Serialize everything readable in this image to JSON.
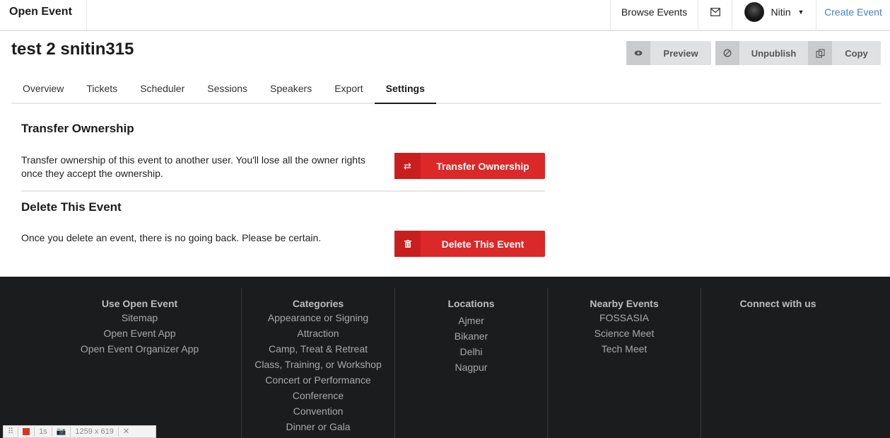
{
  "navbar": {
    "brand": "Open Event",
    "browse_events": "Browse Events",
    "mail_icon": "mail-icon",
    "user_name": "Nitin",
    "create_event": "Create Event"
  },
  "header": {
    "title": "test 2 snitin315",
    "preview": "Preview",
    "unpublish": "Unpublish",
    "copy": "Copy"
  },
  "tabs": [
    "Overview",
    "Tickets",
    "Scheduler",
    "Sessions",
    "Speakers",
    "Export",
    "Settings"
  ],
  "active_tab": "Settings",
  "transfer": {
    "title": "Transfer Ownership",
    "text": "Transfer ownership of this event to another user. You'll lose all the owner rights once they accept the ownership.",
    "button": "Transfer Ownership",
    "icon": "exchange-icon"
  },
  "delete": {
    "title": "Delete This Event",
    "text": "Once you delete an event, there is no going back. Please be certain.",
    "button": "Delete This Event",
    "icon": "trash-icon"
  },
  "footer": {
    "use": {
      "title": "Use Open Event",
      "links": [
        "Sitemap",
        "Open Event App",
        "Open Event Organizer App"
      ]
    },
    "categories": {
      "title": "Categories",
      "links": [
        "Appearance or Signing",
        "Attraction",
        "Camp, Treat & Retreat",
        "Class, Training, or Workshop",
        "Concert or Performance",
        "Conference",
        "Convention",
        "Dinner or Gala"
      ]
    },
    "locations": {
      "title": "Locations",
      "links": [
        "Ajmer",
        "Bikaner",
        "Delhi",
        "Nagpur"
      ]
    },
    "nearby": {
      "title": "Nearby Events",
      "links": [
        "FOSSASIA",
        "Science Meet",
        "Tech Meet"
      ]
    },
    "connect": {
      "title": "Connect with us"
    }
  },
  "widget": {
    "timer": "1s",
    "size": "1259 x 619"
  },
  "colors": {
    "danger": "#db2828",
    "footer_bg": "#1b1c1d",
    "link": "#4183c4"
  }
}
